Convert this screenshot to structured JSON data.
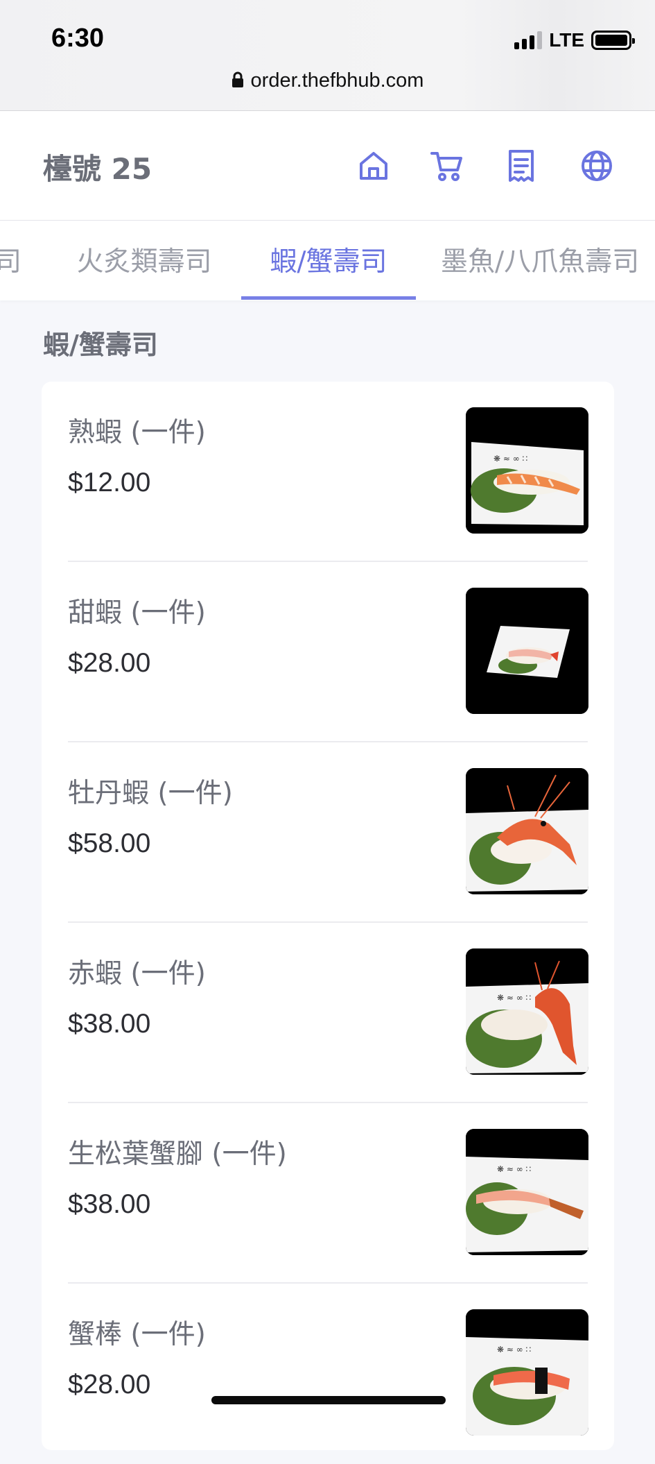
{
  "status_bar": {
    "time": "6:30",
    "network": "LTE"
  },
  "browser": {
    "url": "order.thefbhub.com"
  },
  "header": {
    "table_label": "檯號 25",
    "icons": [
      "home-icon",
      "cart-icon",
      "receipt-icon",
      "globe-icon"
    ]
  },
  "tabs": [
    {
      "label": "司",
      "active": false
    },
    {
      "label": "火炙類壽司",
      "active": false
    },
    {
      "label": "蝦/蟹壽司",
      "active": true
    },
    {
      "label": "墨魚/八爪魚壽司",
      "active": false
    }
  ],
  "section": {
    "title": "蝦/蟹壽司"
  },
  "items": [
    {
      "name": "熟蝦 (一件)",
      "price": "$12.00"
    },
    {
      "name": "甜蝦 (一件)",
      "price": "$28.00"
    },
    {
      "name": "牡丹蝦 (一件)",
      "price": "$58.00"
    },
    {
      "name": "赤蝦 (一件)",
      "price": "$38.00"
    },
    {
      "name": "生松葉蟹腳 (一件)",
      "price": "$38.00"
    },
    {
      "name": "蟹棒 (一件)",
      "price": "$28.00"
    }
  ],
  "colors": {
    "accent": "#6a74e0",
    "text_muted": "#6b6e78",
    "background": "#f6f7fb"
  }
}
